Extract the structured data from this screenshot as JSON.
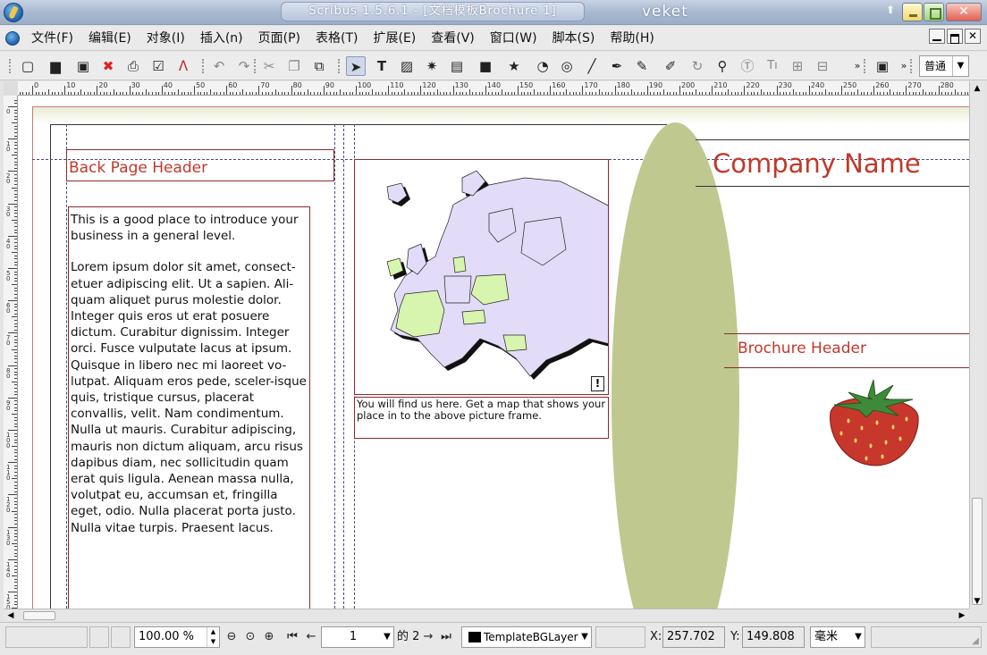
{
  "window": {
    "title": "Scribus 1.5.6.1 - [文档模板Brochure 1]",
    "title_extra": "veket"
  },
  "menu": [
    "文件(F)",
    "编辑(E)",
    "对象(I)",
    "插入(n)",
    "页面(P)",
    "表格(T)",
    "扩展(E)",
    "查看(V)",
    "窗口(W)",
    "脚本(S)",
    "帮助(H)"
  ],
  "toolbar": {
    "tools": [
      {
        "name": "new-document-icon",
        "glyph": "▢"
      },
      {
        "name": "open-folder-icon",
        "glyph": "▆"
      },
      {
        "name": "save-icon",
        "glyph": "▣"
      },
      {
        "name": "close-document-icon",
        "glyph": "✖"
      },
      {
        "name": "print-icon",
        "glyph": "⎙"
      },
      {
        "name": "preflight-check-icon",
        "glyph": "☑"
      },
      {
        "name": "export-pdf-icon",
        "glyph": "ᐱ"
      },
      {
        "name": "undo-icon",
        "glyph": "↶"
      },
      {
        "name": "redo-icon",
        "glyph": "↷"
      },
      {
        "name": "cut-icon",
        "glyph": "✂"
      },
      {
        "name": "copy-icon",
        "glyph": "❐"
      },
      {
        "name": "paste-icon",
        "glyph": "⧉"
      },
      {
        "name": "select-arrow-icon",
        "glyph": "➤"
      },
      {
        "name": "text-frame-icon",
        "glyph": "T"
      },
      {
        "name": "image-frame-icon",
        "glyph": "▨"
      },
      {
        "name": "render-frame-icon",
        "glyph": "✷"
      },
      {
        "name": "table-icon",
        "glyph": "▤"
      },
      {
        "name": "shape-icon",
        "glyph": "■"
      },
      {
        "name": "polygon-star-icon",
        "glyph": "★"
      },
      {
        "name": "arc-icon",
        "glyph": "◔"
      },
      {
        "name": "spiral-icon",
        "glyph": "◎"
      },
      {
        "name": "line-icon",
        "glyph": "╱"
      },
      {
        "name": "bezier-pen-icon",
        "glyph": "✒"
      },
      {
        "name": "freehand-pencil-icon",
        "glyph": "✎"
      },
      {
        "name": "calligraphic-icon",
        "glyph": "✐"
      },
      {
        "name": "rotate-icon",
        "glyph": "↻"
      },
      {
        "name": "zoom-icon",
        "glyph": "⚲"
      },
      {
        "name": "edit-text-icon",
        "glyph": "Ⓣ"
      },
      {
        "name": "text-story-icon",
        "glyph": "Tı"
      },
      {
        "name": "link-frames-icon",
        "glyph": "⊞"
      },
      {
        "name": "unlink-frames-icon",
        "glyph": "⊟"
      },
      {
        "name": "preview-mode-icon",
        "glyph": "▣"
      }
    ],
    "style_combo": "普通"
  },
  "ruler": {
    "labels": [
      "0",
      "10",
      "20",
      "30",
      "40",
      "50",
      "60",
      "70",
      "80",
      "90",
      "100",
      "110",
      "120",
      "130",
      "140",
      "150",
      "160",
      "170",
      "180",
      "190",
      "200",
      "210",
      "220",
      "230",
      "240",
      "250",
      "260",
      "270",
      "280"
    ],
    "vlabels": [
      "0",
      "10",
      "20",
      "30",
      "40",
      "50",
      "60",
      "70",
      "80",
      "90",
      "100",
      "110",
      "120",
      "130",
      "140",
      "150"
    ]
  },
  "page": {
    "back_header": "Back Page Header",
    "body_paragraphs": [
      "This is a good place to introduce your business in a general level.",
      "Lorem ipsum dolor sit amet, consect-etuer adipiscing elit. Ut a sapien. Ali-quam aliquet purus molestie dolor. Integer quis eros ut erat posuere dictum. Curabitur dignissim. Integer orci. Fusce vulputate lacus at ipsum. Quisque in libero nec mi laoreet vo-lutpat. Aliquam eros pede, sceler-isque quis, tristique cursus, placerat convallis, velit. Nam condimentum. Nulla ut mauris. Curabitur adipiscing, mauris non dictum aliquam, arcu risus dapibus diam, nec sollicitudin quam erat quis ligula. Aenean massa nulla, volutpat eu, accumsan et, fringilla eget, odio. Nulla placerat porta justo. Nulla vitae turpis. Praesent lacus."
    ],
    "map_caption": "You will find us here. Get a map that shows your place in to the above picture frame.",
    "map_warning": "!",
    "company_name": "Company Name",
    "brochure_header": "Brochure Header",
    "colors": {
      "accent_red": "#c0392b",
      "frame_border": "#8b2a2a",
      "oval_green": "#bfc88f",
      "map_land": "#e2dcf8",
      "map_highlight": "#d8f5b0"
    }
  },
  "statusbar": {
    "zoom": "100.00 %",
    "page_current": "1",
    "page_of": "的 2",
    "layer": "TemplateBGLayer",
    "x_label": "X:",
    "x_value": "257.702",
    "y_label": "Y:",
    "y_value": "149.808",
    "unit": "毫米"
  }
}
